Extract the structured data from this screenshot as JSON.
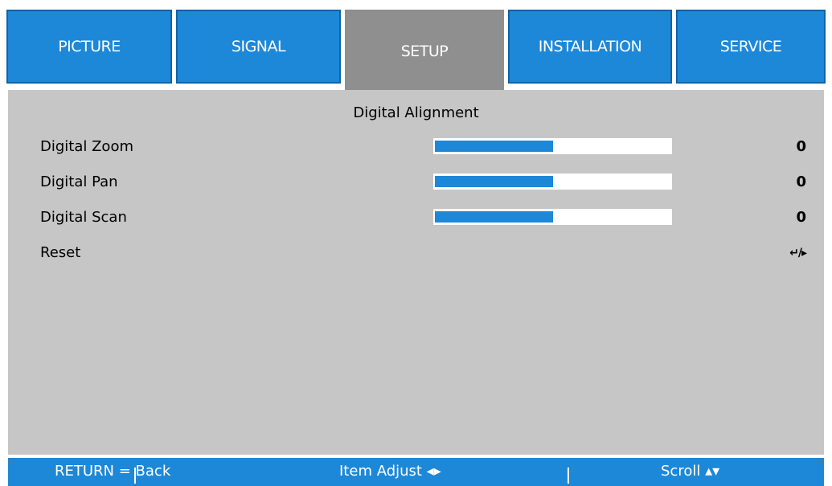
{
  "tabs": [
    {
      "label": "PICTURE",
      "active": false
    },
    {
      "label": "SIGNAL",
      "active": false
    },
    {
      "label": "SETUP",
      "active": true
    },
    {
      "label": "INSTALLATION",
      "active": false
    },
    {
      "label": "SERVICE",
      "active": false
    }
  ],
  "panel": {
    "title": "Digital Alignment",
    "rows": [
      {
        "label": "Digital Zoom",
        "value": "0",
        "fill_fraction": 0.5
      },
      {
        "label": "Digital Pan",
        "value": "0",
        "fill_fraction": 0.5
      },
      {
        "label": "Digital Scan",
        "value": "0",
        "fill_fraction": 0.5
      },
      {
        "label": "Reset",
        "action_glyph": "↵/▸"
      }
    ]
  },
  "footer": {
    "return_text": "RETURN = Back",
    "adjust_text": "Item Adjust ◂▸",
    "scroll_text": "Scroll ▴▾"
  },
  "colors": {
    "tab_blue": "#1e88d8",
    "tab_active_gray": "#8f8f8f",
    "panel_gray": "#c6c6c6"
  }
}
